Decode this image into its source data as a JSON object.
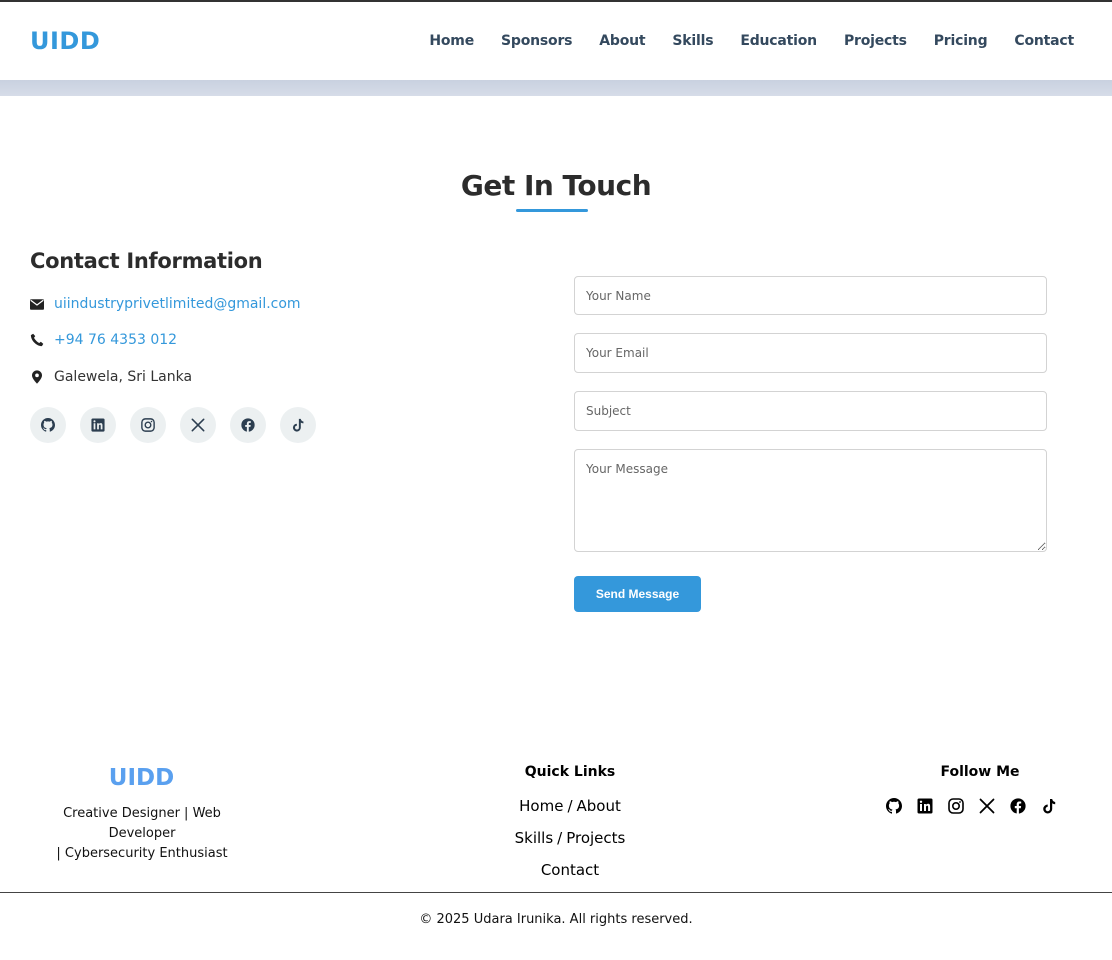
{
  "brand": {
    "logo": "UIDD",
    "accent_color": "#3498db"
  },
  "nav": {
    "items": [
      {
        "label": "Home"
      },
      {
        "label": "Sponsors"
      },
      {
        "label": "About"
      },
      {
        "label": "Skills"
      },
      {
        "label": "Education"
      },
      {
        "label": "Projects"
      },
      {
        "label": "Pricing"
      },
      {
        "label": "Contact"
      }
    ]
  },
  "contact_section": {
    "title": "Get In Touch",
    "info_heading": "Contact Information",
    "email": "uiindustryprivetlimited@gmail.com",
    "phone": "+94 76 4353 012",
    "location": "Galewela, Sri Lanka",
    "socials": [
      "github-icon",
      "linkedin-icon",
      "instagram-icon",
      "x-icon",
      "facebook-icon",
      "tiktok-icon"
    ]
  },
  "form": {
    "name_placeholder": "Your Name",
    "email_placeholder": "Your Email",
    "subject_placeholder": "Subject",
    "message_placeholder": "Your Message",
    "submit_label": "Send Message"
  },
  "footer": {
    "logo": "UIDD",
    "tagline_line1": "Creative Designer | Web Developer",
    "tagline_line2": "| Cybersecurity Enthusiast",
    "quick_links_title": "Quick Links",
    "quick_links": {
      "home": "Home",
      "about": "About",
      "skills": "Skills",
      "projects": "Projects",
      "contact": "Contact",
      "separator": "/"
    },
    "follow_title": "Follow Me",
    "follow_icons": [
      "github-icon",
      "linkedin-icon",
      "instagram-icon",
      "x-icon",
      "facebook-icon",
      "tiktok-icon"
    ],
    "copyright": "© 2025 Udara Irunika. All rights reserved."
  }
}
